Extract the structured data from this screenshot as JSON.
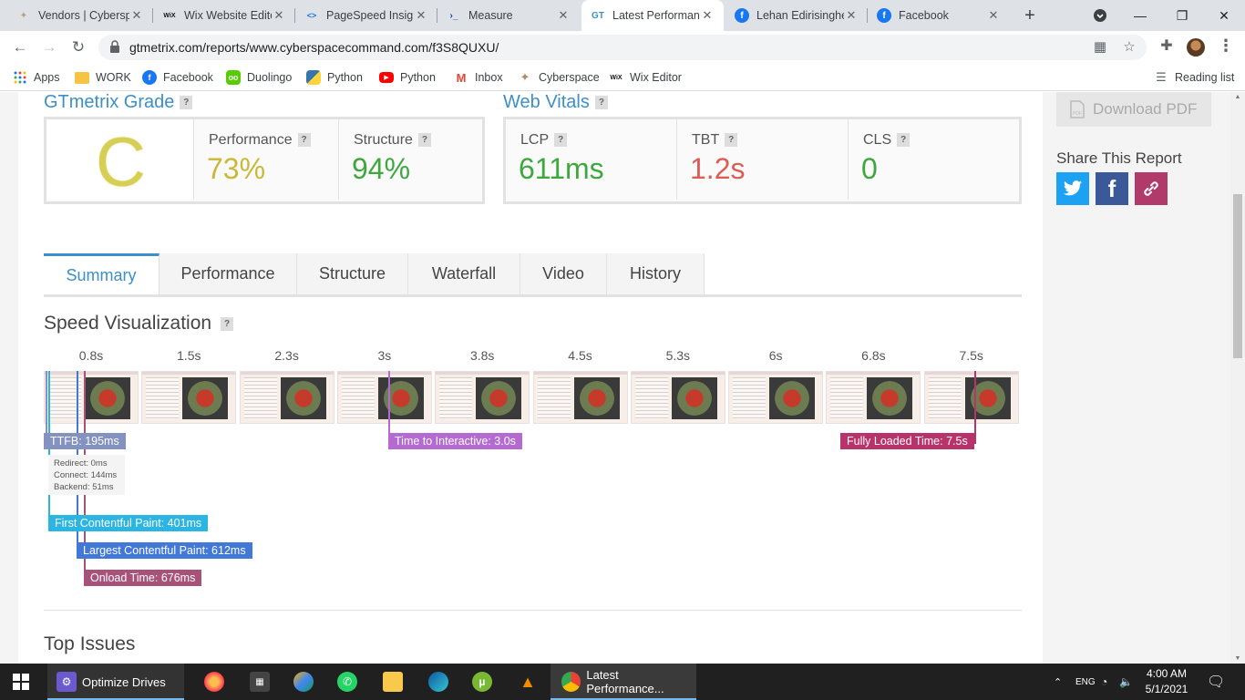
{
  "browser": {
    "tabs": [
      {
        "title": "Vendors | Cybersp",
        "icon": "cyberspace-icon",
        "active": false
      },
      {
        "title": "Wix Website Edito",
        "icon": "wix-icon",
        "active": false
      },
      {
        "title": "PageSpeed Insigh",
        "icon": "pagespeed-icon",
        "active": false
      },
      {
        "title": "Measure",
        "icon": "measure-icon",
        "active": false
      },
      {
        "title": "Latest Performanc",
        "icon": "gtmetrix-icon",
        "active": true
      },
      {
        "title": "Lehan Edirisinghe",
        "icon": "facebook-icon",
        "active": false
      },
      {
        "title": "Facebook",
        "icon": "facebook-icon",
        "active": false
      }
    ],
    "tab_icon_text": {
      "cyberspace": "✦",
      "wix": "WiX",
      "pagespeed": "<>",
      "measure": "›_",
      "gtmetrix": "GT",
      "facebook": "f"
    },
    "url": "gtmetrix.com/reports/www.cyberspacecommand.com/f3S8QUXU/",
    "bookmarks": [
      {
        "label": "Apps",
        "icon": "apps-grid-icon"
      },
      {
        "label": "WORK",
        "icon": "folder-icon"
      },
      {
        "label": "Facebook",
        "icon": "facebook-icon"
      },
      {
        "label": "Duolingo",
        "icon": "duolingo-icon"
      },
      {
        "label": "Python",
        "icon": "python-icon"
      },
      {
        "label": "Python",
        "icon": "youtube-icon"
      },
      {
        "label": "Inbox",
        "icon": "gmail-icon"
      },
      {
        "label": "Cyberspace",
        "icon": "cyberspace-icon"
      },
      {
        "label": "Wix Editor",
        "icon": "wix-icon"
      }
    ],
    "reading_list": "Reading list"
  },
  "grade": {
    "title": "GTmetrix Grade",
    "help": "?",
    "letter": "C",
    "performance_label": "Performance",
    "performance_value": "73%",
    "structure_label": "Structure",
    "structure_value": "94%"
  },
  "vitals": {
    "title": "Web Vitals",
    "help": "?",
    "lcp_label": "LCP",
    "lcp_value": "611ms",
    "tbt_label": "TBT",
    "tbt_value": "1.2s",
    "cls_label": "CLS",
    "cls_value": "0"
  },
  "sidebar": {
    "download_pdf": "Download PDF",
    "share_title": "Share This Report"
  },
  "report_tabs": [
    "Summary",
    "Performance",
    "Structure",
    "Waterfall",
    "Video",
    "History"
  ],
  "speed": {
    "title": "Speed Visualization",
    "help": "?",
    "times": [
      "0.8s",
      "1.5s",
      "2.3s",
      "3s",
      "3.8s",
      "4.5s",
      "5.3s",
      "6s",
      "6.8s",
      "7.5s"
    ],
    "ttfb": "TTFB: 195ms",
    "redirect": "Redirect: 0ms",
    "connect": "Connect: 144ms",
    "backend": "Backend: 51ms",
    "fcp": "First Contentful Paint: 401ms",
    "lcp": "Largest Contentful Paint: 612ms",
    "onload": "Onload Time: 676ms",
    "tti": "Time to Interactive: 3.0s",
    "fully_loaded": "Fully Loaded Time: 7.5s"
  },
  "top_issues": "Top Issues",
  "colors": {
    "grade_c": "#d6cf54",
    "perf": "#cbb838",
    "good": "#3ea83e",
    "bad": "#dd5d54",
    "ttfb": "#8492c0",
    "fcp": "#2bb5e3",
    "lcp": "#4278d8",
    "onload": "#a8527a",
    "tti": "#b46ad0",
    "fully": "#b8336a"
  },
  "taskbar": {
    "optimize_drives": "Optimize Drives",
    "chrome_window": "Latest Performance...",
    "time": "4:00 AM",
    "date": "5/1/2021",
    "lang": "ENG"
  }
}
